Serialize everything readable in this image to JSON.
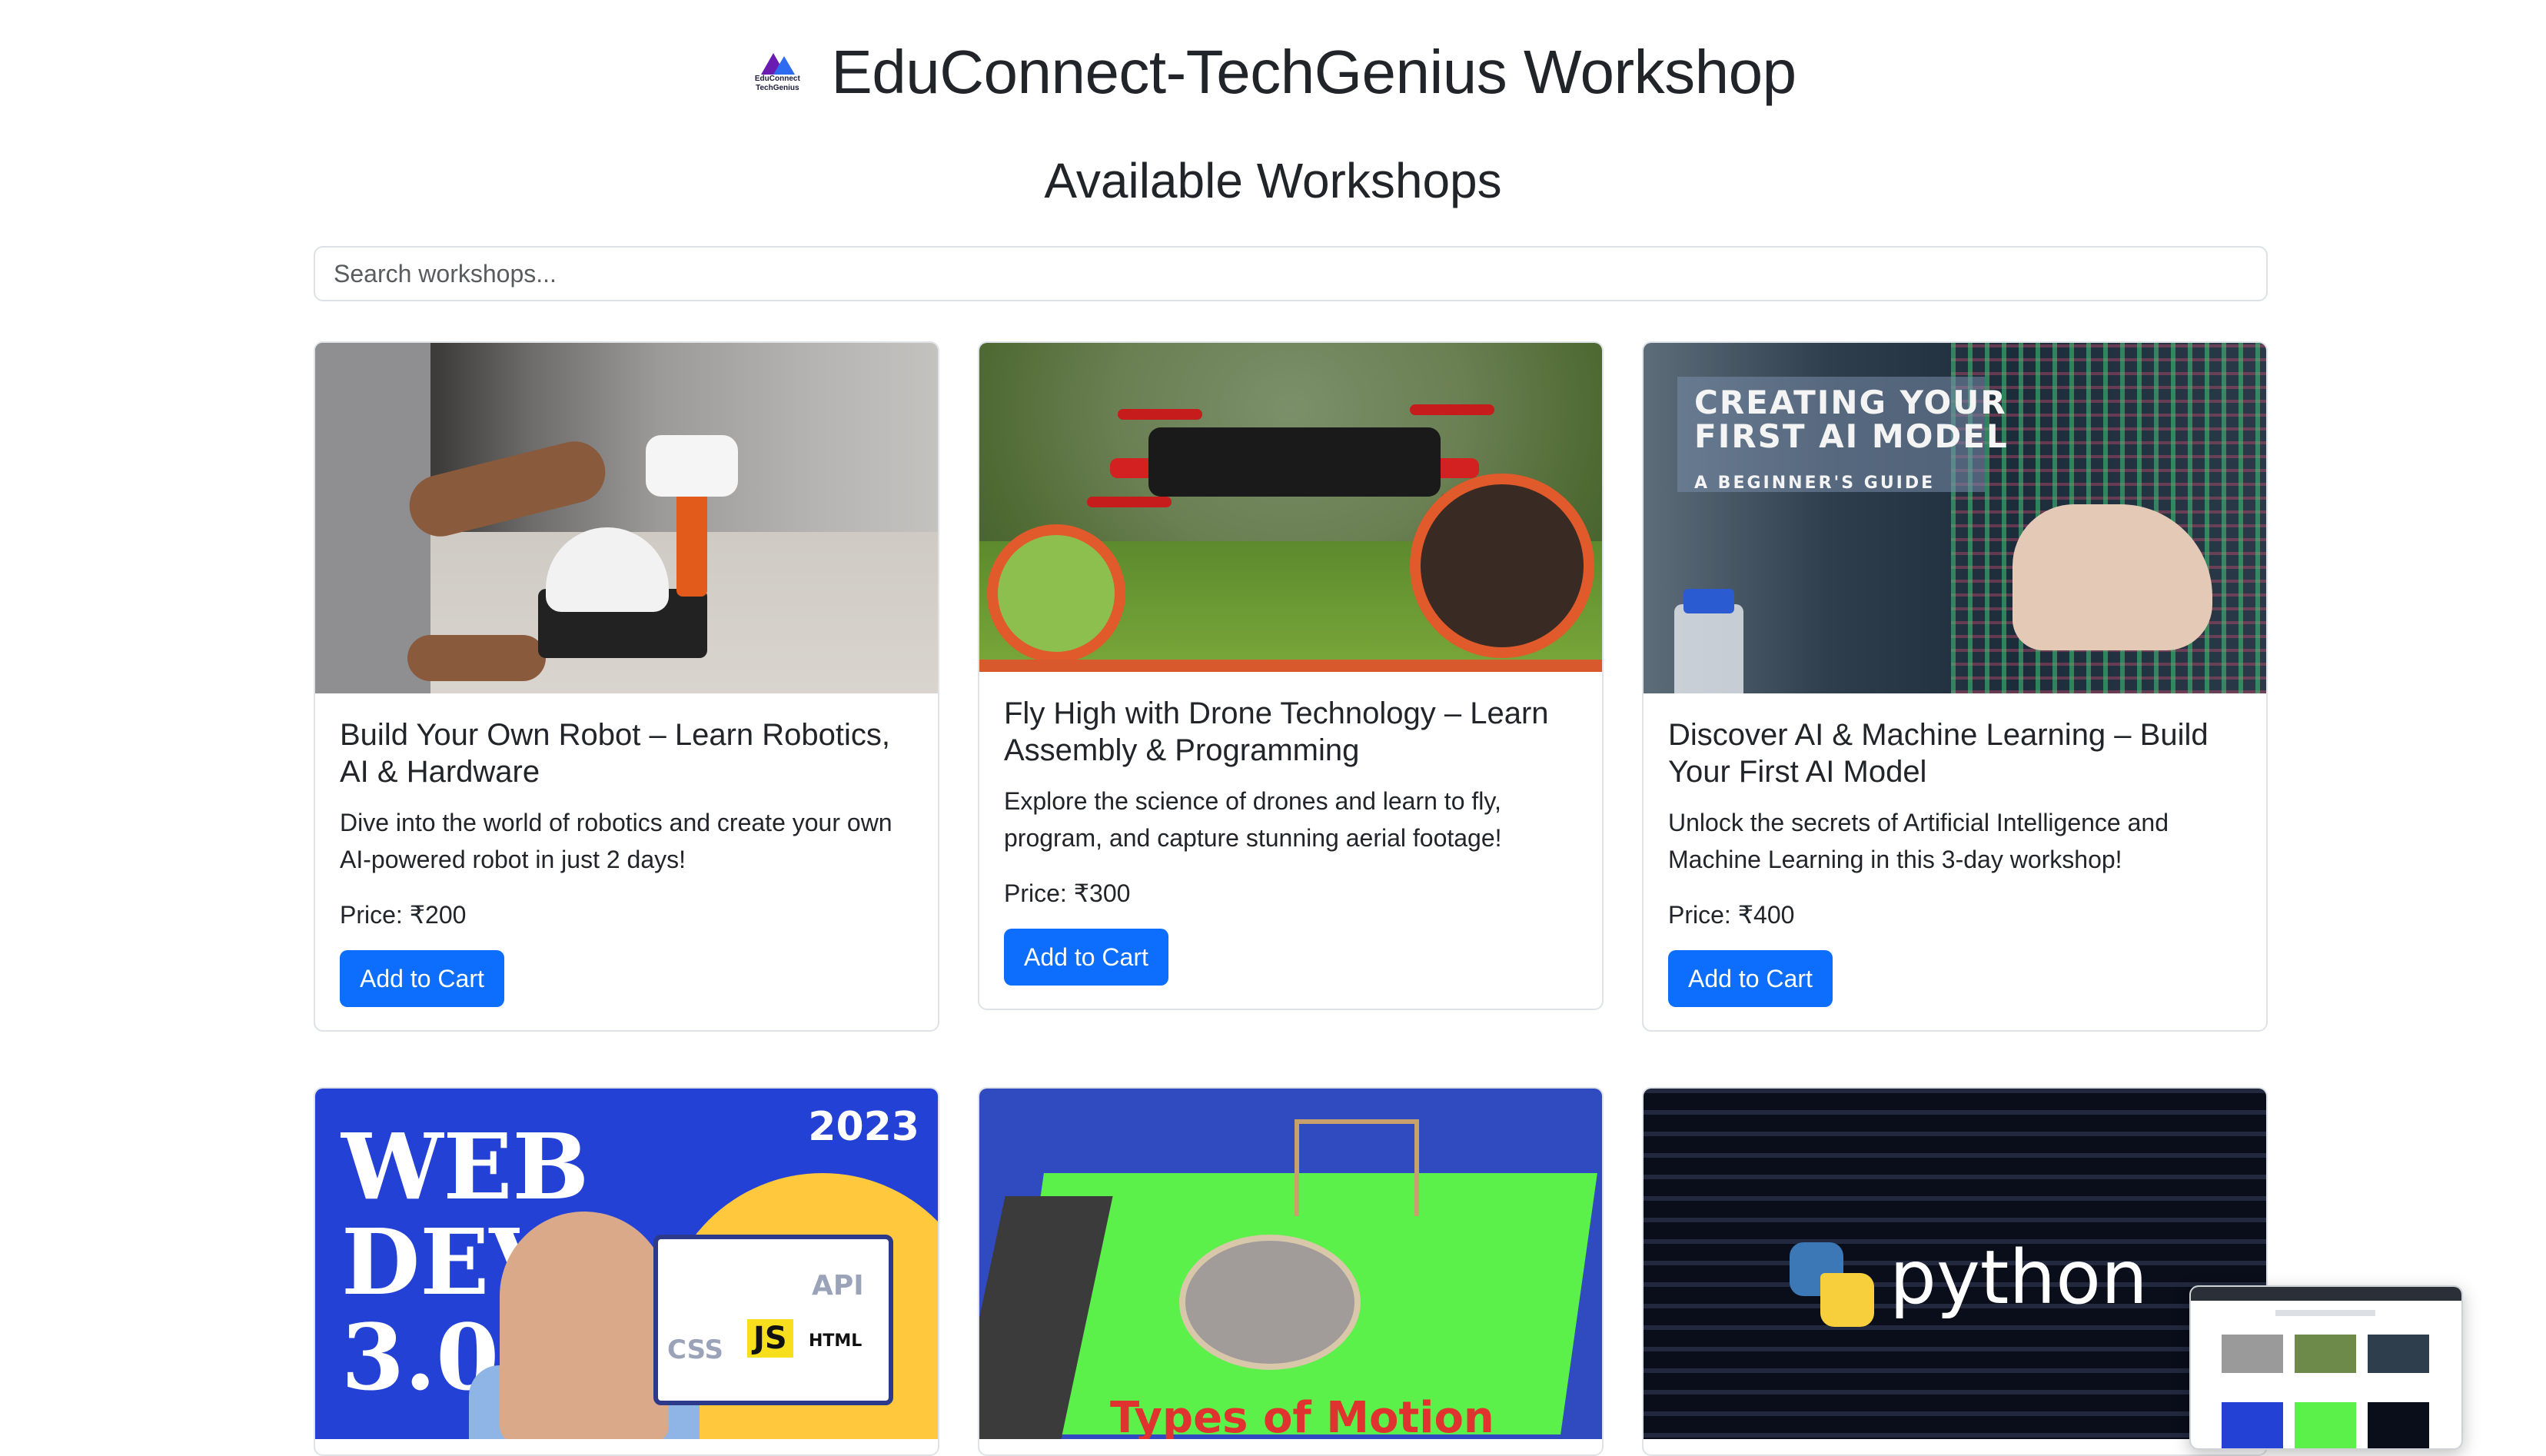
{
  "header": {
    "logo_line1": "EduConnect",
    "logo_line2": "TechGenius",
    "title": "EduConnect-TechGenius Workshop"
  },
  "section_title": "Available Workshops",
  "search": {
    "placeholder": "Search workshops..."
  },
  "workshops": [
    {
      "title": "Build Your Own Robot – Learn Robotics, AI & Hardware",
      "description": "Dive into the world of robotics and create your own AI-powered robot in just 2 days!",
      "price_label": "Price:",
      "price": "₹200",
      "button": "Add to Cart",
      "image_icon": "robot-image"
    },
    {
      "title": "Fly High with Drone Technology – Learn Assembly & Programming",
      "description": "Explore the science of drones and learn to fly, program, and capture stunning aerial footage!",
      "price_label": "Price:",
      "price": "₹300",
      "button": "Add to Cart",
      "image_icon": "drone-image"
    },
    {
      "title": "Discover AI & Machine Learning – Build Your First AI Model",
      "description": "Unlock the secrets of Artificial Intelligence and Machine Learning in this 3-day workshop!",
      "price_label": "Price:",
      "price": "₹400",
      "button": "Add to Cart",
      "image_icon": "ai-image",
      "image_text_1": "CREATING YOUR",
      "image_text_2": "FIRST AI MODEL",
      "image_text_3": "A BEGINNER'S GUIDE"
    }
  ],
  "row2_images": [
    {
      "icon": "web-dev-image",
      "text_main_1": "WEB",
      "text_main_2": "DEV",
      "text_main_3": "3.0",
      "year": "2023",
      "tags": [
        "CSS",
        "JS",
        "API",
        "HTML"
      ]
    },
    {
      "icon": "motion-image",
      "text": "Types of Motion"
    },
    {
      "icon": "python-image",
      "text": "python"
    }
  ],
  "colors": {
    "primary_button": "#0d6efd",
    "text": "#212529",
    "border": "#dee2e6"
  }
}
